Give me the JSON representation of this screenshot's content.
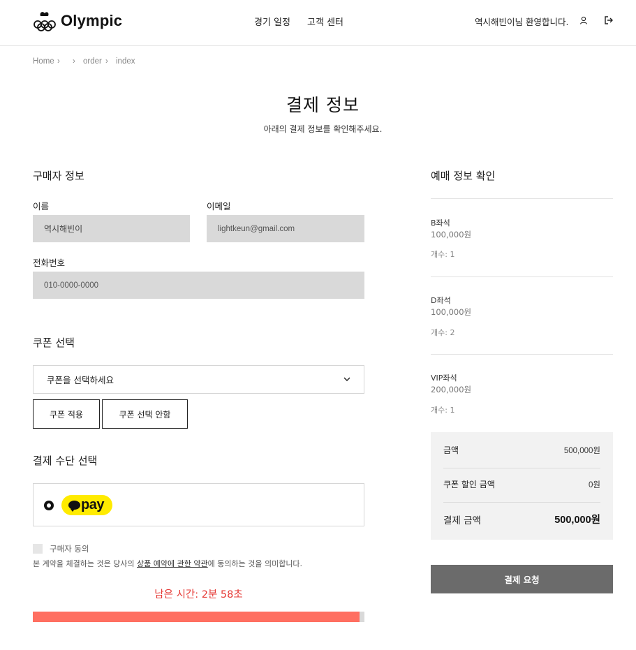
{
  "header": {
    "logo_text": "Olympic",
    "nav": [
      "경기 일정",
      "고객 센터"
    ],
    "welcome": "역시해빈이님 환영합니다.",
    "icons": [
      "user-icon",
      "logout-icon"
    ]
  },
  "breadcrumb": [
    "Home",
    "order",
    "index"
  ],
  "page": {
    "title": "결제 정보",
    "subtitle": "아래의 결제 정보를 확인해주세요."
  },
  "buyer": {
    "title": "구매자 정보",
    "name_label": "이름",
    "name_value": "역시해빈이",
    "email_label": "이메일",
    "email_value": "lightkeun@gmail.com",
    "phone_label": "전화번호",
    "phone_value": "010-0000-0000"
  },
  "coupon": {
    "title": "쿠폰 선택",
    "select_value": "쿠폰을 선택하세요",
    "apply_button": "쿠폰 적용",
    "none_button": "쿠폰 선택 안함"
  },
  "payment_method": {
    "title": "결제 수단 선택",
    "option": "pay"
  },
  "agreement": {
    "checkbox_label": "구매자 동의",
    "text_before": "본 계약을 체결하는 것은 당사의 ",
    "link": "상품 예약에 관한 약관",
    "text_after": "에 동의하는 것을 의미합니다."
  },
  "timer": {
    "text": "남은 시간: 2분 58초",
    "progress": 0.985
  },
  "reservation": {
    "title": "예매 정보 확인",
    "seats": [
      {
        "name": "B좌석",
        "price": "100,000원",
        "count": "개수: 1"
      },
      {
        "name": "D좌석",
        "price": "100,000원",
        "count": "개수: 2"
      },
      {
        "name": "VIP좌석",
        "price": "200,000원",
        "count": "개수: 1"
      }
    ]
  },
  "summary": {
    "amount_label": "금액",
    "amount_value": "500,000원",
    "discount_label": "쿠폰 할인 금액",
    "discount_value": "0원",
    "total_label": "결제 금액",
    "total_value": "500,000원"
  },
  "pay_button": "결제 요청",
  "colors": {
    "timer": "#e53935",
    "progress": "#ff6f61",
    "kakaopay": "#ffeb00",
    "pay_button": "#6b6b6b"
  }
}
